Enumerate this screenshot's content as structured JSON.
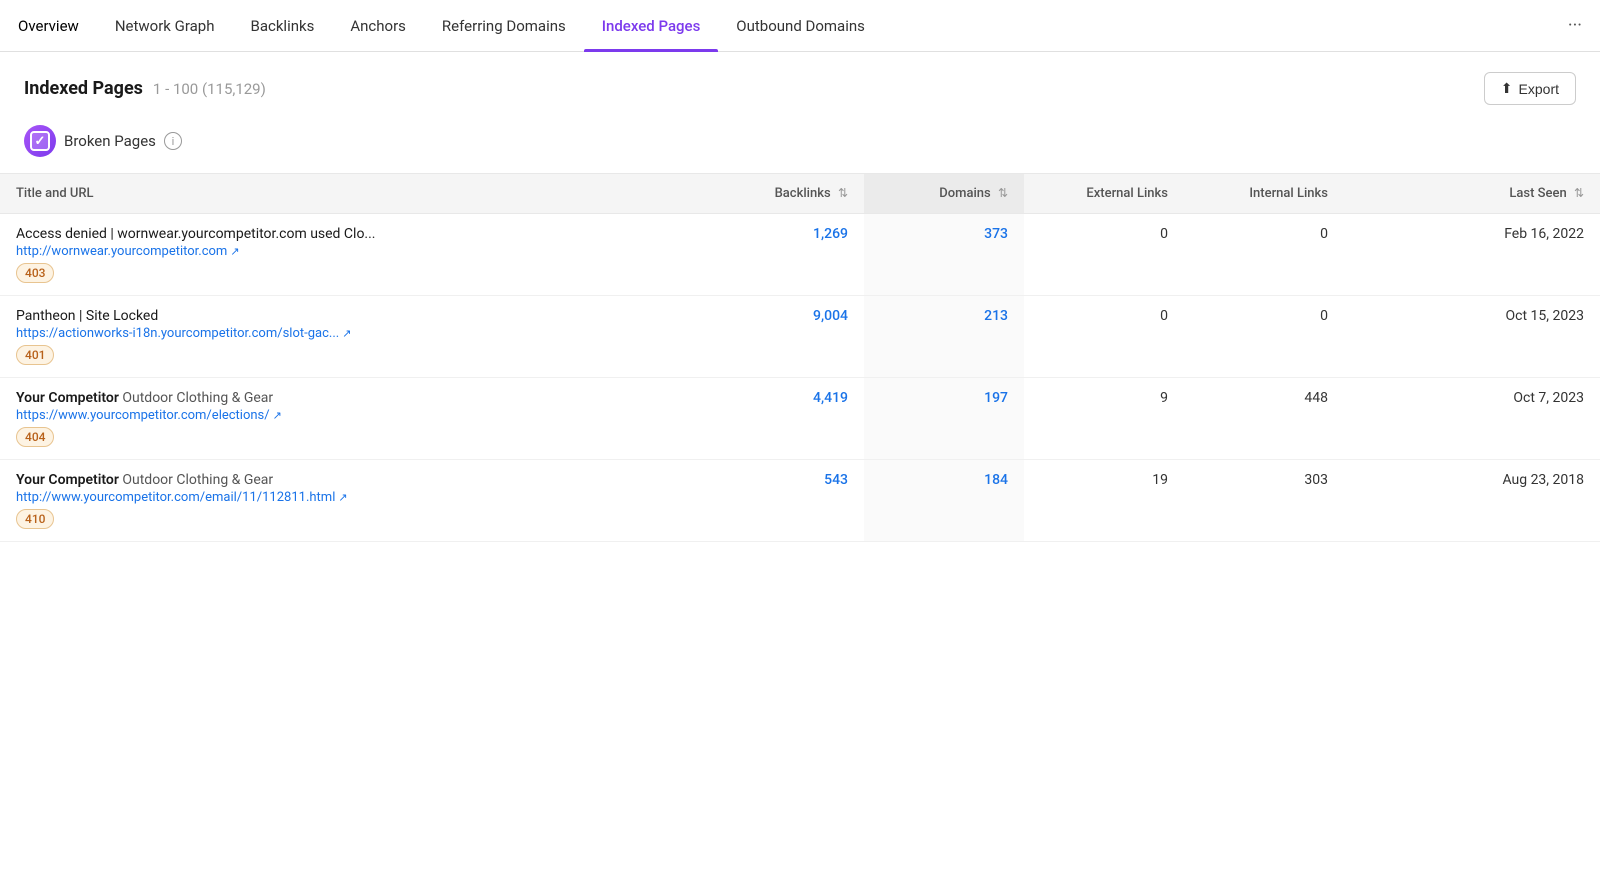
{
  "nav": {
    "items": [
      {
        "id": "overview",
        "label": "Overview",
        "active": false
      },
      {
        "id": "network-graph",
        "label": "Network Graph",
        "active": false
      },
      {
        "id": "backlinks",
        "label": "Backlinks",
        "active": false
      },
      {
        "id": "anchors",
        "label": "Anchors",
        "active": false
      },
      {
        "id": "referring-domains",
        "label": "Referring Domains",
        "active": false
      },
      {
        "id": "indexed-pages",
        "label": "Indexed Pages",
        "active": true
      },
      {
        "id": "outbound-domains",
        "label": "Outbound Domains",
        "active": false
      }
    ],
    "more_label": "···"
  },
  "header": {
    "title": "Indexed Pages",
    "range": "1 - 100 (115,129)",
    "export_label": "Export"
  },
  "filter": {
    "label": "Broken Pages",
    "checked": true,
    "info_icon": "i"
  },
  "table": {
    "columns": [
      {
        "id": "title-url",
        "label": "Title and URL",
        "sortable": false
      },
      {
        "id": "backlinks",
        "label": "Backlinks",
        "sortable": true
      },
      {
        "id": "domains",
        "label": "Domains",
        "sortable": true,
        "highlight": true
      },
      {
        "id": "external-links",
        "label": "External Links",
        "sortable": false
      },
      {
        "id": "internal-links",
        "label": "Internal Links",
        "sortable": false
      },
      {
        "id": "last-seen",
        "label": "Last Seen",
        "sortable": true
      }
    ],
    "rows": [
      {
        "title_bold": "Access denied | wornwear.yourcompetitor.com used Clo...",
        "title_normal": "",
        "url": "http://wornwear.yourcompetitor.com",
        "status": "403",
        "backlinks": "1,269",
        "domains": "373",
        "external_links": "0",
        "internal_links": "0",
        "last_seen": "Feb 16, 2022"
      },
      {
        "title_bold": "Pantheon | Site Locked",
        "title_normal": "",
        "url": "https://actionworks-i18n.yourcompetitor.com/slot-gac...",
        "status": "401",
        "backlinks": "9,004",
        "domains": "213",
        "external_links": "0",
        "internal_links": "0",
        "last_seen": "Oct 15, 2023"
      },
      {
        "title_bold": "Your Competitor",
        "title_normal": "Outdoor Clothing & Gear",
        "url": "https://www.yourcompetitor.com/elections/",
        "status": "404",
        "backlinks": "4,419",
        "domains": "197",
        "external_links": "9",
        "internal_links": "448",
        "last_seen": "Oct 7, 2023"
      },
      {
        "title_bold": "Your Competitor",
        "title_normal": "Outdoor Clothing & Gear",
        "url": "http://www.yourcompetitor.com/email/11/112811.html",
        "status": "410",
        "backlinks": "543",
        "domains": "184",
        "external_links": "19",
        "internal_links": "303",
        "last_seen": "Aug 23, 2018"
      }
    ]
  },
  "icons": {
    "export": "↑",
    "external_link": "↗",
    "check": "✓",
    "sort": "⇅",
    "sort_active": "↕"
  }
}
